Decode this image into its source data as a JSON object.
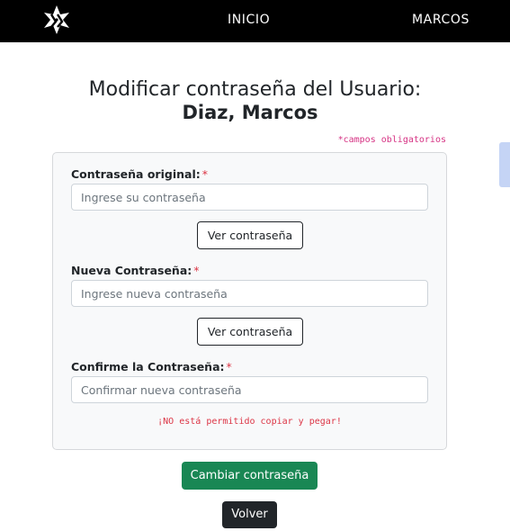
{
  "navbar": {
    "logo_icon": "brand-logo-icon",
    "links": [
      {
        "label": "INICIO"
      },
      {
        "label": "MARCOS"
      }
    ]
  },
  "page": {
    "title": "Modificar contraseña del Usuario:",
    "user_name": "Diaz, Marcos",
    "required_note": "*campos obligatorios"
  },
  "form": {
    "fields": [
      {
        "label": "Contraseña original:",
        "required_mark": "*",
        "placeholder": "Ingrese su contraseña",
        "value": ""
      },
      {
        "label": "Nueva Contraseña:",
        "required_mark": "*",
        "placeholder": "Ingrese nueva contraseña",
        "value": ""
      },
      {
        "label": "Confirme la Contraseña:",
        "required_mark": "*",
        "placeholder": "Confirmar nueva contraseña",
        "value": ""
      }
    ],
    "show_password_label": "Ver contraseña",
    "warning": "¡NO está permitido copiar y pegar!"
  },
  "actions": {
    "submit_label": "Cambiar contraseña",
    "back_label": "Volver"
  },
  "colors": {
    "navbar": "#000000",
    "success": "#198754",
    "dark": "#212529",
    "required": "#dc3545",
    "note": "#d63384"
  }
}
